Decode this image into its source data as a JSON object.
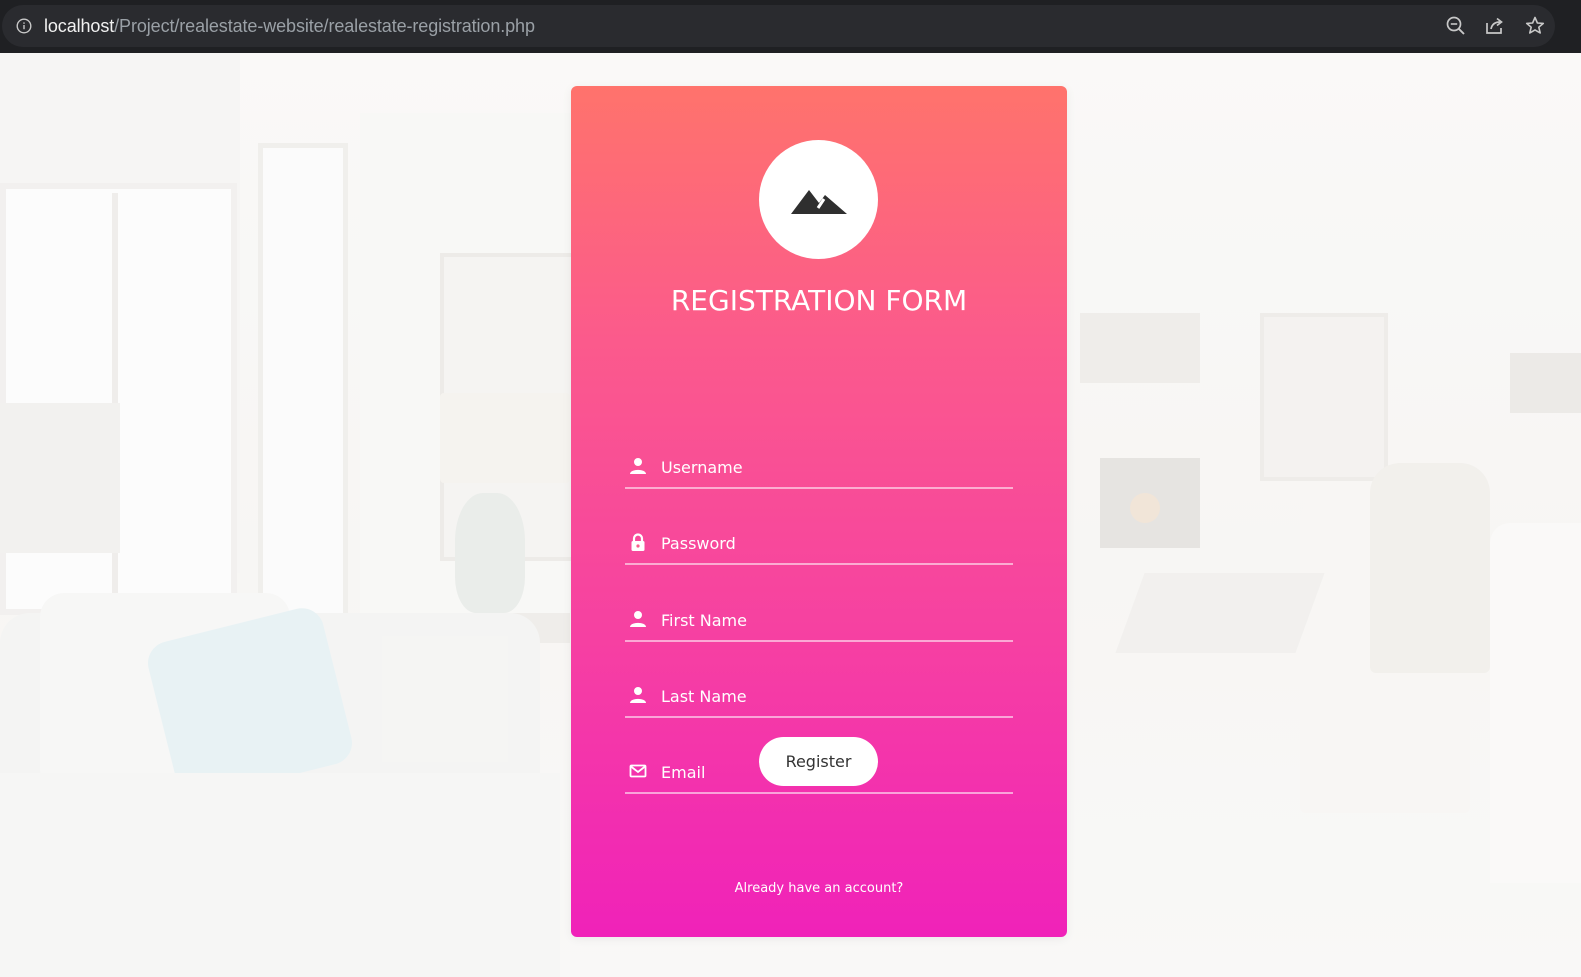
{
  "browser": {
    "url_host": "localhost",
    "url_path": "/Project/realestate-website/realestate-registration.php",
    "icons": [
      "info-icon",
      "zoom-out-icon",
      "share-icon",
      "bookmark-star-icon"
    ]
  },
  "form": {
    "logo_icon": "mountain-icon",
    "title": "REGISTRATION FORM",
    "fields": [
      {
        "placeholder": "Username",
        "icon": "user-icon",
        "value": ""
      },
      {
        "placeholder": "Password",
        "icon": "lock-icon",
        "value": ""
      },
      {
        "placeholder": "First Name",
        "icon": "user-icon",
        "value": ""
      },
      {
        "placeholder": "Last Name",
        "icon": "user-icon",
        "value": ""
      },
      {
        "placeholder": "Email",
        "icon": "envelope-icon",
        "value": ""
      }
    ],
    "register_label": "Register",
    "account_link": "Already have an account?"
  },
  "colors": {
    "gradient_top": "#ff736c",
    "gradient_bottom": "#f022b9",
    "browser_bar": "#1f2023",
    "omnibox": "#2a2b2f"
  }
}
